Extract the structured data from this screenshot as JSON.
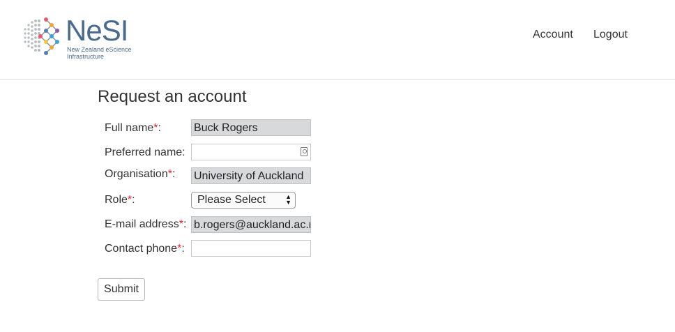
{
  "brand": {
    "name": "NeSI",
    "subtitle_line1": "New Zealand eScience",
    "subtitle_line2": "Infrastructure"
  },
  "nav": {
    "account": "Account",
    "logout": "Logout"
  },
  "page": {
    "title": "Request an account"
  },
  "form": {
    "full_name": {
      "label": "Full name",
      "required": "*",
      "suffix": ":",
      "value": "Buck Rogers"
    },
    "preferred": {
      "label": "Preferred name:",
      "value": ""
    },
    "organisation": {
      "label": "Organisation",
      "required": "*",
      "suffix": ":",
      "value": "University of Auckland"
    },
    "role": {
      "label": "Role",
      "required": "*",
      "suffix": ":",
      "value": "Please Select"
    },
    "email": {
      "label": "E-mail address",
      "required": "*",
      "suffix": ":",
      "value": "b.rogers@auckland.ac.nz"
    },
    "phone": {
      "label": "Contact phone",
      "required": "*",
      "suffix": ":",
      "value": ""
    },
    "submit_label": "Submit"
  },
  "colors": {
    "required": "#e0202a",
    "brand": "#4a6a8c",
    "autofill": "#d7d9da"
  }
}
